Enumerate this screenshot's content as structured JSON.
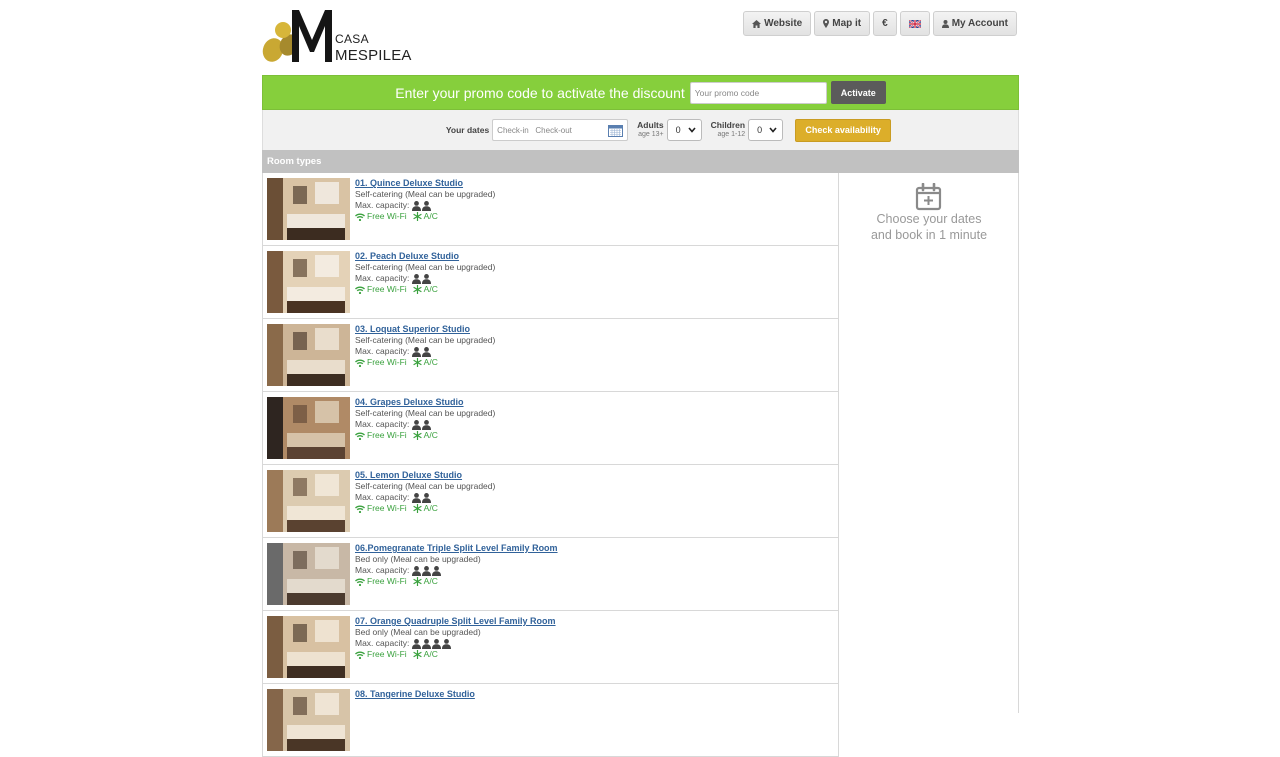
{
  "header": {
    "logo_casa": "CASA",
    "logo_name": "MESPILEA",
    "nav": {
      "website": "Website",
      "map": "Map it",
      "currency": "€",
      "account": "My Account"
    }
  },
  "promo": {
    "text": "Enter your promo code to activate the discount",
    "placeholder": "Your promo code",
    "button": "Activate"
  },
  "search": {
    "dates_label": "Your dates",
    "dates_placeholder": "Check-in   Check-out",
    "adults_label": "Adults",
    "adults_sub": "age 13+",
    "adults_value": "0",
    "children_label": "Children",
    "children_sub": "age 1-12",
    "children_value": "0",
    "button": "Check availability"
  },
  "room_types_label": "Room types",
  "capacity_label": "Max. capacity:",
  "amenities": {
    "wifi": "Free Wi-Fi",
    "ac": "A/C"
  },
  "rooms": [
    {
      "name": "01. Quince Deluxe Studio",
      "meal": "Self-catering (Meal can be upgraded)",
      "capacity": 2
    },
    {
      "name": "02. Peach Deluxe Studio",
      "meal": "Self-catering (Meal can be upgraded)",
      "capacity": 2
    },
    {
      "name": "03. Loquat Superior Studio",
      "meal": "Self-catering (Meal can be upgraded)",
      "capacity": 2
    },
    {
      "name": "04. Grapes Deluxe Studio",
      "meal": "Self-catering (Meal can be upgraded)",
      "capacity": 2
    },
    {
      "name": "05. Lemon Deluxe Studio",
      "meal": "Self-catering (Meal can be upgraded)",
      "capacity": 2
    },
    {
      "name": "06.Pomegranate Triple Split Level Family Room",
      "meal": "Bed only (Meal can be upgraded)",
      "capacity": 3
    },
    {
      "name": "07. Orange Quadruple Split Level Family Room",
      "meal": "Bed only (Meal can be upgraded)",
      "capacity": 4
    },
    {
      "name": "08. Tangerine Deluxe Studio",
      "meal": "",
      "capacity": 0
    }
  ],
  "sidebar": {
    "line1": "Choose your dates",
    "line2": "and book in 1 minute"
  },
  "colors": {
    "promo_bg": "#86cf3c",
    "check_btn": "#dcae2a",
    "room_link": "#31629a",
    "amenity": "#3aa13e"
  }
}
